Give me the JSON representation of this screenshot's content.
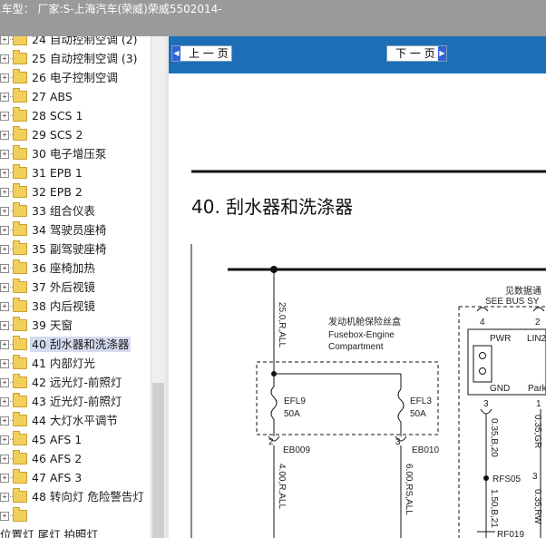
{
  "window": {
    "title": "1车型：  厂家:S-上海汽车(荣威)荣威5502014-"
  },
  "tree": {
    "items": [
      {
        "label": "24 自动控制空调 (2)",
        "selected": false
      },
      {
        "label": "25 自动控制空调 (3)",
        "selected": false
      },
      {
        "label": "26 电子控制空调",
        "selected": false
      },
      {
        "label": "27 ABS",
        "selected": false
      },
      {
        "label": "28 SCS 1",
        "selected": false
      },
      {
        "label": "29 SCS 2",
        "selected": false
      },
      {
        "label": "30 电子增压泵",
        "selected": false
      },
      {
        "label": "31 EPB 1",
        "selected": false
      },
      {
        "label": "32 EPB 2",
        "selected": false
      },
      {
        "label": "33 组合仪表",
        "selected": false
      },
      {
        "label": "34 驾驶员座椅",
        "selected": false
      },
      {
        "label": "35 副驾驶座椅",
        "selected": false
      },
      {
        "label": "36 座椅加热",
        "selected": false
      },
      {
        "label": "37 外后视镜",
        "selected": false
      },
      {
        "label": "38 内后视镜",
        "selected": false
      },
      {
        "label": "39 天窗",
        "selected": false
      },
      {
        "label": "40 刮水器和洗涤器",
        "selected": true
      },
      {
        "label": "41 内部灯光",
        "selected": false
      },
      {
        "label": "42 远光灯-前照灯",
        "selected": false
      },
      {
        "label": "43 近光灯-前照灯",
        "selected": false
      },
      {
        "label": "44 大灯水平调节",
        "selected": false
      },
      {
        "label": "45 AFS 1",
        "selected": false
      },
      {
        "label": "46 AFS 2",
        "selected": false
      },
      {
        "label": "47 AFS 3",
        "selected": false
      },
      {
        "label": "48 转向灯 危险警告灯",
        "selected": false
      },
      {
        "label": "",
        "selected": false
      }
    ],
    "wrapped_text": "位置灯 尾灯 拍照灯"
  },
  "viewer": {
    "prev_label": "上 一 页",
    "next_label": "下 一 页",
    "section_title": "40. 刮水器和洗涤器",
    "diagram": {
      "wire_left": "25.0,R,ALL",
      "fusebox_cn": "发动机舱保险丝盒",
      "fusebox_en1": "Fusebox-Engine",
      "fusebox_en2": "Compartment",
      "fuse1_name": "EFL9",
      "fuse1_rating": "50A",
      "fuse2_name": "EFL3",
      "fuse2_rating": "50A",
      "pin_eb009": "2",
      "pin_eb010": "3",
      "conn_eb009": "EB009",
      "conn_eb010": "EB010",
      "wire_eb009": "4.00,R,ALL",
      "wire_eb010": "6.00,RS,ALL",
      "see_cn": "见数据通",
      "see_en": "SEE BUS SY",
      "pin4": "4",
      "pin2": "2",
      "pwr": "PWR",
      "lin2": "LIN2",
      "gnd": "GND",
      "park": "Park",
      "pin3a": "3",
      "pin1": "1",
      "pin3b": "3",
      "wire_b20": "0.35,B,20",
      "wire_gr": "0.35,GR",
      "wire_b21": "1.50,B,21",
      "wire_rw": "0.35,RW",
      "rfs05": "RFS05",
      "rf019": "RF019"
    }
  },
  "colors": {
    "titlebar": "#9a9a9a",
    "viewer_bg": "#1c6fb6",
    "selected": "#d5dcef",
    "folder": "#f2cf5b"
  }
}
